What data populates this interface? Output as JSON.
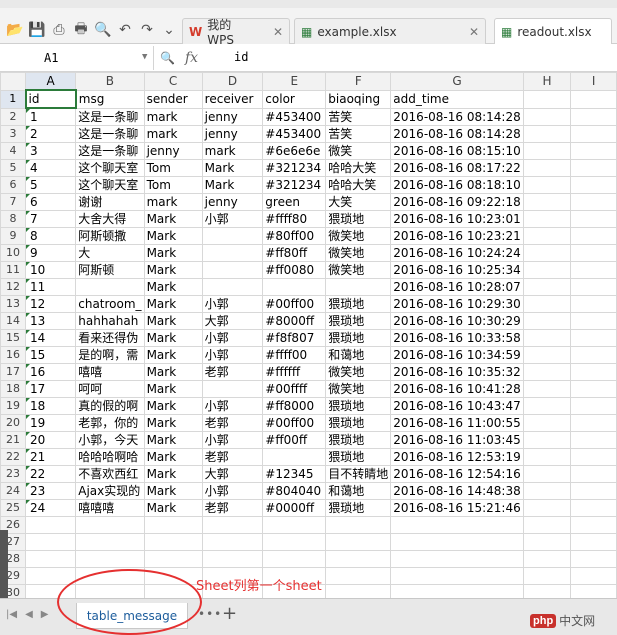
{
  "tabs": [
    {
      "label": "我的WPS",
      "icon": "wps-icon",
      "closable": true
    },
    {
      "label": "example.xlsx",
      "icon": "spreadsheet-icon",
      "closable": true
    },
    {
      "label": "readout.xlsx",
      "icon": "spreadsheet-icon",
      "closable": false
    }
  ],
  "formula_bar": {
    "cell_ref": "A1",
    "fx_label": "fx",
    "value": "id"
  },
  "columns": [
    "A",
    "B",
    "C",
    "D",
    "E",
    "F",
    "G",
    "H",
    "I"
  ],
  "rows": [
    [
      "id",
      "msg",
      "sender",
      "receiver",
      "color",
      "biaoqing",
      "add_time",
      "",
      ""
    ],
    [
      "1",
      "这是一条聊",
      "mark",
      "jenny",
      "#453400",
      "苦笑",
      "2016-08-16 08:14:28",
      "",
      ""
    ],
    [
      "2",
      "这是一条聊",
      "mark",
      "jenny",
      "#453400",
      "苦笑",
      "2016-08-16 08:14:28",
      "",
      ""
    ],
    [
      "3",
      "这是一条聊",
      "jenny",
      "mark",
      "#6e6e6e",
      "微笑",
      "2016-08-16 08:15:10",
      "",
      ""
    ],
    [
      "4",
      "这个聊天室",
      "Tom",
      "Mark",
      "#321234",
      "哈哈大笑",
      "2016-08-16 08:17:22",
      "",
      ""
    ],
    [
      "5",
      "这个聊天室",
      "Tom",
      "Mark",
      "#321234",
      "哈哈大笑",
      "2016-08-16 08:18:10",
      "",
      ""
    ],
    [
      "6",
      "谢谢",
      "mark",
      "jenny",
      "green",
      "大笑",
      "2016-08-16 09:22:18",
      "",
      ""
    ],
    [
      "7",
      "大舍大得",
      "Mark",
      "小郭",
      "#ffff80",
      "猥琐地",
      "2016-08-16 10:23:01",
      "",
      ""
    ],
    [
      "8",
      "阿斯顿撒",
      "Mark",
      "",
      "#80ff00",
      "微笑地",
      "2016-08-16 10:23:21",
      "",
      ""
    ],
    [
      "9",
      "大",
      "Mark",
      "",
      "#ff80ff",
      "微笑地",
      "2016-08-16 10:24:24",
      "",
      ""
    ],
    [
      "10",
      "阿斯顿",
      "Mark",
      "",
      "#ff0080",
      "微笑地",
      "2016-08-16 10:25:34",
      "",
      ""
    ],
    [
      "11",
      "",
      "Mark",
      "",
      "",
      "",
      "2016-08-16 10:28:07",
      "",
      ""
    ],
    [
      "12",
      "chatroom_",
      "Mark",
      "小郭",
      "#00ff00",
      "猥琐地",
      "2016-08-16 10:29:30",
      "",
      ""
    ],
    [
      "13",
      "hahhahah",
      "Mark",
      "大郭",
      "#8000ff",
      "猥琐地",
      "2016-08-16 10:30:29",
      "",
      ""
    ],
    [
      "14",
      "看来还得伪",
      "Mark",
      "小郭",
      "#f8f807",
      "猥琐地",
      "2016-08-16 10:33:58",
      "",
      ""
    ],
    [
      "15",
      "是的啊，需",
      "Mark",
      "小郭",
      "#ffff00",
      "和蔼地",
      "2016-08-16 10:34:59",
      "",
      ""
    ],
    [
      "16",
      "嘻嘻",
      "Mark",
      "老郭",
      "#ffffff",
      "微笑地",
      "2016-08-16 10:35:32",
      "",
      ""
    ],
    [
      "17",
      "呵呵",
      "Mark",
      "",
      "#00ffff",
      "微笑地",
      "2016-08-16 10:41:28",
      "",
      ""
    ],
    [
      "18",
      "真的假的啊",
      "Mark",
      "小郭",
      "#ff8000",
      "猥琐地",
      "2016-08-16 10:43:47",
      "",
      ""
    ],
    [
      "19",
      "老郭，你的",
      "Mark",
      "老郭",
      "#00ff00",
      "猥琐地",
      "2016-08-16 11:00:55",
      "",
      ""
    ],
    [
      "20",
      "小郭，今天",
      "Mark",
      "小郭",
      "#ff00ff",
      "猥琐地",
      "2016-08-16 11:03:45",
      "",
      ""
    ],
    [
      "21",
      "哈哈哈啊哈",
      "Mark",
      "老郭",
      "",
      "猥琐地",
      "2016-08-16 12:53:19",
      "",
      ""
    ],
    [
      "22",
      "不喜欢西红",
      "Mark",
      "大郭",
      "#12345",
      "目不转睛地",
      "2016-08-16 12:54:16",
      "",
      ""
    ],
    [
      "23",
      "Ajax实现的",
      "Mark",
      "小郭",
      "#804040",
      "和蔼地",
      "2016-08-16 14:48:38",
      "",
      ""
    ],
    [
      "24",
      "嘻嘻嘻",
      "Mark",
      "老郭",
      "#0000ff",
      "猥琐地",
      "2016-08-16 15:21:46",
      "",
      ""
    ],
    [
      "",
      "",
      "",
      "",
      "",
      "",
      "",
      "",
      ""
    ],
    [
      "",
      "",
      "",
      "",
      "",
      "",
      "",
      "",
      ""
    ],
    [
      "",
      "",
      "",
      "",
      "",
      "",
      "",
      "",
      ""
    ],
    [
      "",
      "",
      "",
      "",
      "",
      "",
      "",
      "",
      ""
    ],
    [
      "",
      "",
      "",
      "",
      "",
      "",
      "",
      "",
      ""
    ]
  ],
  "sheet": {
    "name": "table_message",
    "more": "•••",
    "add": "+"
  },
  "annotation": "Sheet列第一个sheet",
  "watermark": {
    "badge": "php",
    "text": "中文网"
  },
  "colors": {
    "selection": "#2b7b3a",
    "annotation": "#e53030",
    "sheet_tab_text": "#1c5c9c"
  }
}
